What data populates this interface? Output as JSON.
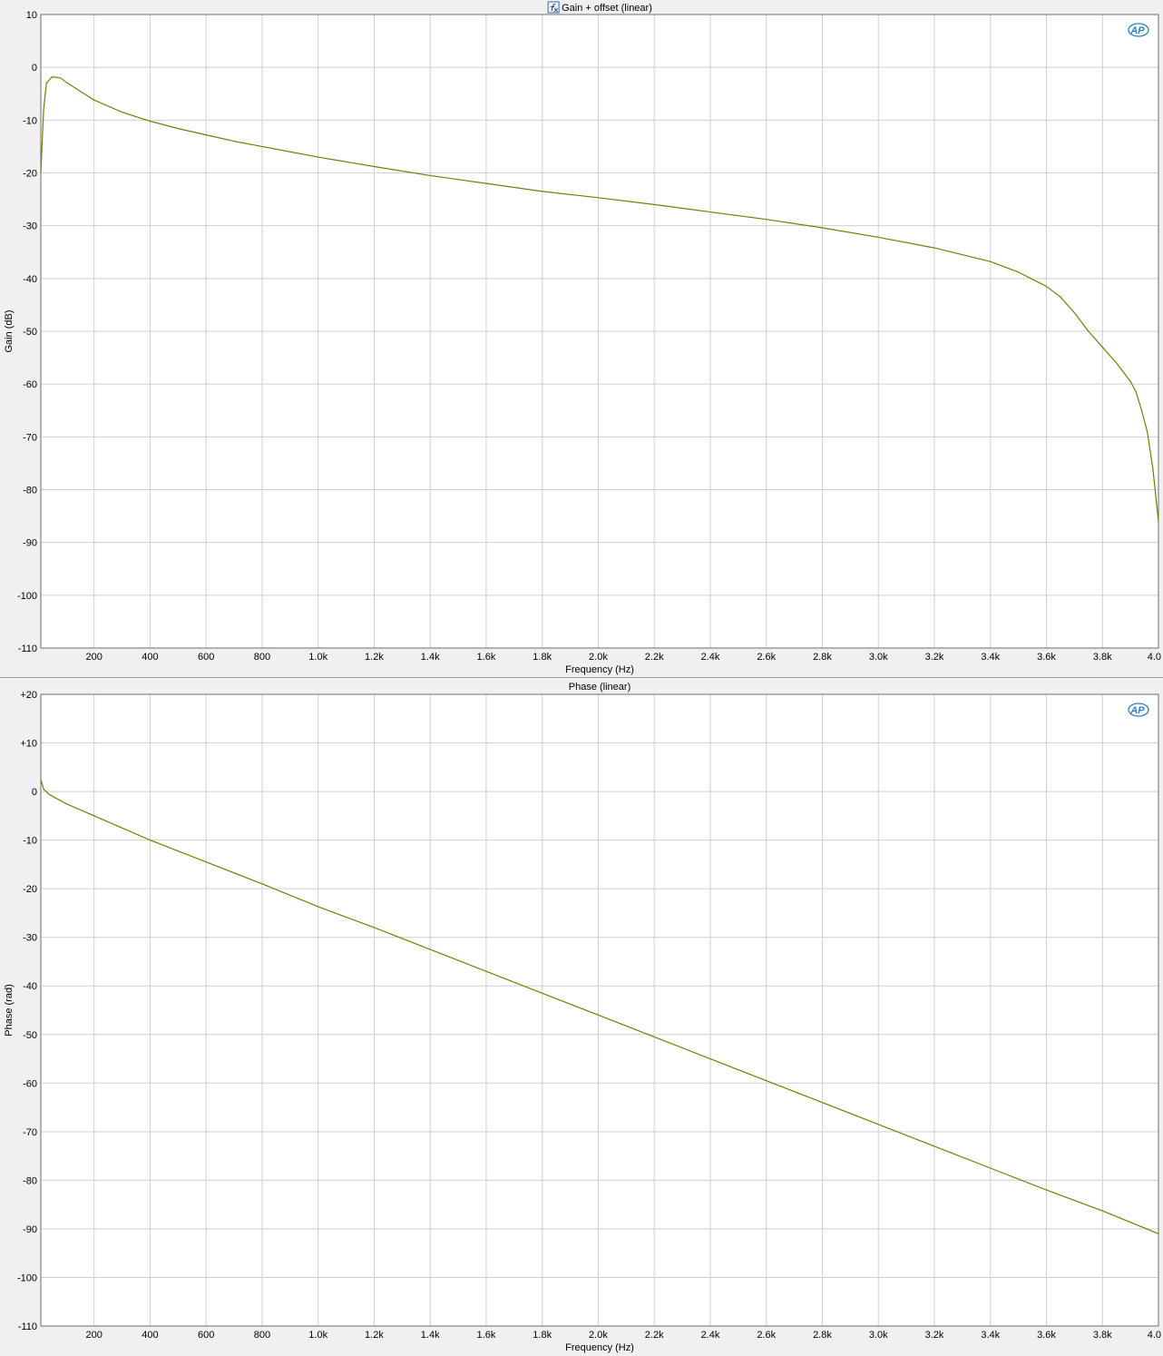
{
  "charts": [
    {
      "id": "gain",
      "title": "Gain + offset (linear)",
      "title_icon": "fx-icon",
      "logo": "AP",
      "xlabel": "Frequency (Hz)",
      "ylabel": "Gain (dB)",
      "x_ticks": [
        "200",
        "400",
        "600",
        "800",
        "1.0k",
        "1.2k",
        "1.4k",
        "1.6k",
        "1.8k",
        "2.0k",
        "2.2k",
        "2.4k",
        "2.6k",
        "2.8k",
        "3.0k",
        "3.2k",
        "3.4k",
        "3.6k",
        "3.8k",
        "4.0"
      ],
      "y_ticks": [
        "10",
        "0",
        "-10",
        "-20",
        "-30",
        "-40",
        "-50",
        "-60",
        "-70",
        "-80",
        "-90",
        "-100",
        "-110"
      ]
    },
    {
      "id": "phase",
      "title": "Phase (linear)",
      "title_icon": "",
      "logo": "AP",
      "xlabel": "Frequency (Hz)",
      "ylabel": "Phase (rad)",
      "x_ticks": [
        "200",
        "400",
        "600",
        "800",
        "1.0k",
        "1.2k",
        "1.4k",
        "1.6k",
        "1.8k",
        "2.0k",
        "2.2k",
        "2.4k",
        "2.6k",
        "2.8k",
        "3.0k",
        "3.2k",
        "3.4k",
        "3.6k",
        "3.8k",
        "4.0"
      ],
      "y_ticks": [
        "+20",
        "+10",
        "0",
        "-10",
        "-20",
        "-30",
        "-40",
        "-50",
        "-60",
        "-70",
        "-80",
        "-90",
        "-100",
        "-110"
      ]
    }
  ],
  "chart_data": [
    {
      "type": "line",
      "title": "Gain + offset (linear)",
      "xlabel": "Frequency (Hz)",
      "ylabel": "Gain (dB)",
      "xlim": [
        10,
        4000
      ],
      "ylim": [
        -110,
        10
      ],
      "grid": true,
      "line_color": "#7a7a00",
      "x": [
        10,
        20,
        30,
        50,
        80,
        100,
        150,
        200,
        300,
        400,
        500,
        600,
        700,
        800,
        900,
        1000,
        1200,
        1400,
        1600,
        1800,
        2000,
        2200,
        2400,
        2600,
        2800,
        3000,
        3200,
        3400,
        3500,
        3600,
        3650,
        3700,
        3750,
        3800,
        3850,
        3900,
        3920,
        3940,
        3960,
        3980,
        4000
      ],
      "y": [
        -20,
        -8,
        -3,
        -1.8,
        -2,
        -2.8,
        -4.5,
        -6.2,
        -8.5,
        -10.2,
        -11.6,
        -12.8,
        -14,
        -15,
        -16,
        -17,
        -18.8,
        -20.5,
        -22,
        -23.5,
        -24.7,
        -26,
        -27.4,
        -28.8,
        -30.4,
        -32.2,
        -34.2,
        -36.8,
        -38.8,
        -41.5,
        -43.5,
        -46.5,
        -50,
        -53,
        -56,
        -59.5,
        -61.5,
        -65,
        -69,
        -76,
        -86
      ]
    },
    {
      "type": "line",
      "title": "Phase (linear)",
      "xlabel": "Frequency (Hz)",
      "ylabel": "Phase (rad)",
      "xlim": [
        10,
        4000
      ],
      "ylim": [
        -110,
        20
      ],
      "grid": true,
      "line_color": "#7a7a00",
      "x": [
        10,
        20,
        40,
        100,
        200,
        400,
        600,
        800,
        1000,
        1200,
        1400,
        1600,
        1800,
        2000,
        2200,
        2400,
        2600,
        2800,
        3000,
        3200,
        3400,
        3600,
        3800,
        4000
      ],
      "y": [
        2.5,
        0.5,
        -0.6,
        -2.5,
        -5,
        -10,
        -14.5,
        -19,
        -23.7,
        -28,
        -32.5,
        -37,
        -41.5,
        -46,
        -50.5,
        -55,
        -59.5,
        -64,
        -68.5,
        -73,
        -77.5,
        -82,
        -86.3,
        -91
      ]
    }
  ]
}
